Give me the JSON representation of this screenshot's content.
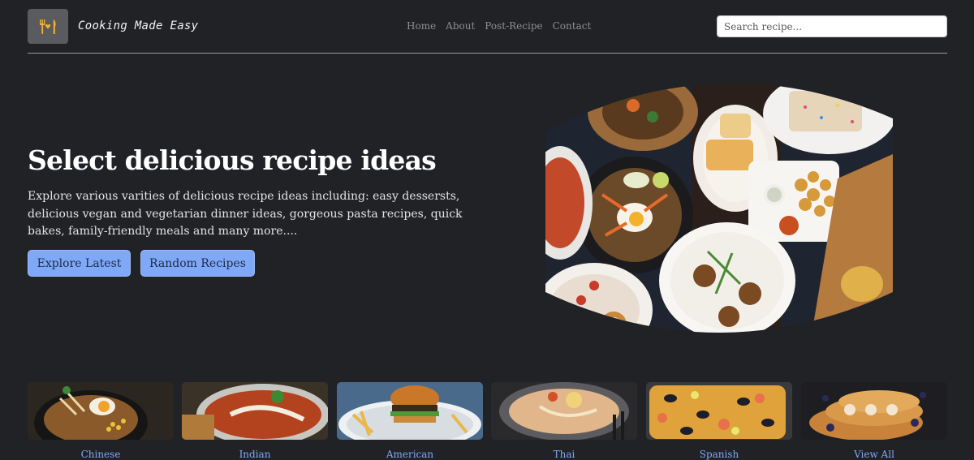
{
  "header": {
    "brand": "Cooking Made Easy",
    "logo_icon": "fork-heart-knife-icon",
    "nav": [
      "Home",
      "About",
      "Post-Recipe",
      "Contact"
    ],
    "search_placeholder": "Search recipe..."
  },
  "hero": {
    "title": "Select delicious recipe ideas",
    "text": "Explore various varities of delicious recipe ideas including: easy dessersts, delicious vegan and vegetarian dinner ideas, gorgeous pasta recipes, quick bakes, family-friendly meals and many more....",
    "buttons": {
      "latest": "Explore Latest",
      "random": "Random Recipes"
    }
  },
  "categories": [
    "Chinese",
    "Indian",
    "American",
    "Thai",
    "Spanish",
    "View All"
  ],
  "colors": {
    "background": "#212226",
    "accent": "#7fa9f7",
    "muted_nav": "#8d8e92"
  }
}
